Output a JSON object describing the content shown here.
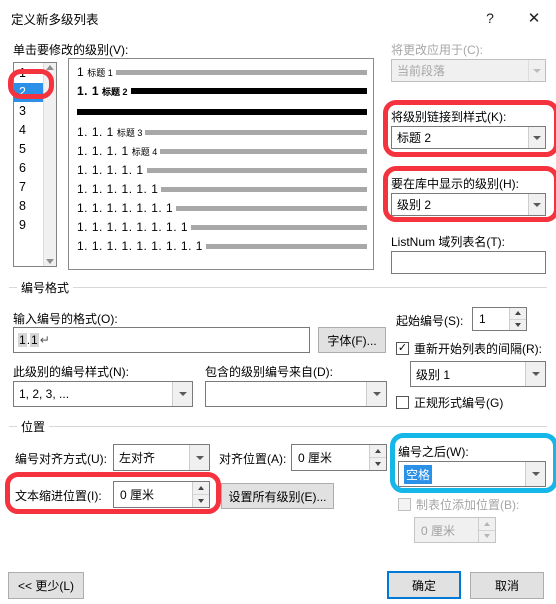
{
  "window": {
    "title": "定义新多级列表",
    "help_label": "?",
    "close_label": "✕"
  },
  "left": {
    "level_label": "单击要修改的级别(V):",
    "levels": [
      "1",
      "2",
      "3",
      "4",
      "5",
      "6",
      "7",
      "8",
      "9"
    ],
    "selected_level": "2"
  },
  "preview": {
    "rows": [
      {
        "num": "1",
        "heading": "标题 1",
        "active": false
      },
      {
        "num": "1. 1",
        "heading": "标题 2",
        "active": true
      },
      {
        "num": "",
        "heading": "",
        "active": false,
        "solid": true
      },
      {
        "num": "1. 1. 1",
        "heading": "标题 3",
        "active": false
      },
      {
        "num": "1. 1. 1. 1",
        "heading": "标题 4",
        "active": false
      },
      {
        "num": "1. 1. 1. 1. 1",
        "heading": "",
        "active": false
      },
      {
        "num": "1. 1. 1. 1. 1. 1",
        "heading": "",
        "active": false
      },
      {
        "num": "1. 1. 1. 1. 1. 1. 1",
        "heading": "",
        "active": false
      },
      {
        "num": "1. 1. 1. 1. 1. 1. 1. 1",
        "heading": "",
        "active": false
      },
      {
        "num": "1. 1. 1. 1. 1. 1. 1. 1. 1",
        "heading": "",
        "active": false
      }
    ]
  },
  "right_top": {
    "apply_label": "将更改应用于(C):",
    "apply_value": "当前段落",
    "link_style_label": "将级别链接到样式(K):",
    "link_style_value": "标题 2",
    "gallery_label": "要在库中显示的级别(H):",
    "gallery_value": "级别 2",
    "listnum_label": "ListNum 域列表名(T):",
    "listnum_value": ""
  },
  "number_format": {
    "group_title": "编号格式",
    "format_label": "输入编号的格式(O):",
    "format_value": "1.1",
    "format_field_a": "1",
    "format_sep": ".",
    "format_field_b": "1",
    "format_cursor": "↵",
    "font_button": "字体(F)...",
    "style_label": "此级别的编号样式(N):",
    "style_value": "1, 2, 3, ...",
    "include_label": "包含的级别编号来自(D):",
    "include_value": "",
    "start_at_label": "起始编号(S):",
    "start_at_value": "1",
    "restart_label": "重新开始列表的间隔(R):",
    "restart_checked": true,
    "restart_value": "级别 1",
    "legal_label": "正规形式编号(G)",
    "legal_checked": false
  },
  "position": {
    "group_title": "位置",
    "align_label": "编号对齐方式(U):",
    "align_value": "左对齐",
    "aligned_at_label": "对齐位置(A):",
    "aligned_at_value": "0 厘米",
    "indent_label": "文本缩进位置(I):",
    "indent_value": "0 厘米",
    "set_all_button": "设置所有级别(E)...",
    "follow_label": "编号之后(W):",
    "follow_value": "空格",
    "tab_label": "制表位添加位置(B):",
    "tab_checked": false,
    "tab_value": "0 厘米"
  },
  "footer": {
    "less_button": "<< 更少(L)",
    "ok_button": "确定",
    "cancel_button": "取消"
  },
  "colors": {
    "annotation_red": "#f5333f",
    "annotation_cyan": "#15b7e8",
    "selection_blue": "#2b90e8",
    "default_button_border": "#0078d7"
  }
}
